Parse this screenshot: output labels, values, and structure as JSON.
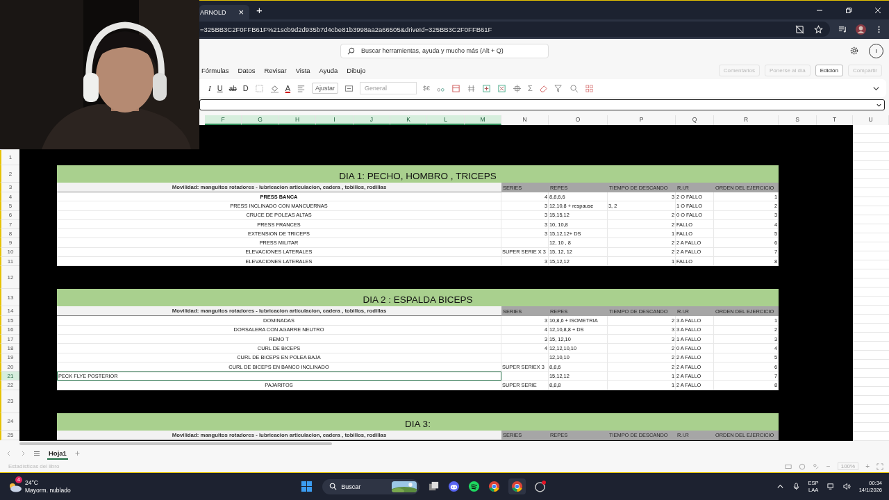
{
  "browser": {
    "tab_title": "ARNOLD",
    "tab_close": "×",
    "new_tab": "+",
    "url": "=325BB3C2F0FFB61F%21scb9d2d935b7d4cbe81b3998aa2a66505&driveId=325BB3C2F0FFB61F"
  },
  "app": {
    "search_placeholder": "Buscar herramientas, ayuda y mucho más (Alt + Q)",
    "user_initial": "I",
    "menu": [
      "Fórmulas",
      "Datos",
      "Revisar",
      "Vista",
      "Ayuda",
      "Dibujo"
    ],
    "actions": [
      {
        "label": "Comentarios",
        "disabled": true
      },
      {
        "label": "Ponerse al día",
        "disabled": true
      },
      {
        "label": "Edición",
        "disabled": false
      },
      {
        "label": "Compartir",
        "disabled": true
      }
    ],
    "toolbar": {
      "glyphs": [
        "I",
        "U",
        "ab",
        "D"
      ],
      "font_color": "A",
      "wrap": "Ajustar",
      "number_format": "General",
      "currency": "$€",
      "sum": "Σ"
    }
  },
  "columns": [
    {
      "label": "F",
      "selected": true
    },
    {
      "label": "G",
      "selected": true
    },
    {
      "label": "H",
      "selected": true
    },
    {
      "label": "I",
      "selected": true
    },
    {
      "label": "J",
      "selected": true
    },
    {
      "label": "K",
      "selected": true
    },
    {
      "label": "L",
      "selected": true
    },
    {
      "label": "M",
      "selected": true
    },
    {
      "label": "N",
      "selected": false
    },
    {
      "label": "O",
      "selected": false
    },
    {
      "label": "P",
      "selected": false
    },
    {
      "label": "Q",
      "selected": false
    },
    {
      "label": "R",
      "selected": false
    },
    {
      "label": "S",
      "selected": false
    },
    {
      "label": "T",
      "selected": false
    },
    {
      "label": "U",
      "selected": false
    }
  ],
  "sheet": {
    "rows": [
      {
        "number": "1",
        "kind": "blank",
        "selected": false
      },
      {
        "number": "2",
        "kind": "title",
        "selected": false,
        "text": "DIA 1: PECHO, HOMBRO , TRICEPS"
      },
      {
        "number": "3",
        "kind": "header",
        "selected": false,
        "mobility": "Movilidad: manguitos rotadores - lubricacion articulacion, cadera , tobillos, rodillas",
        "headers": [
          "SERIES",
          "REPES",
          "TIEMPO DE DESCANDO",
          "R.I.R",
          "ORDEN DEL EJERCICIO"
        ]
      },
      {
        "number": "4",
        "kind": "exercise",
        "selected": false,
        "bold": true,
        "cells": [
          "PRESS BANCA",
          "4",
          "8,8,6,6",
          "3",
          "2 O FALLO",
          "1"
        ]
      },
      {
        "number": "5",
        "kind": "exercise",
        "selected": false,
        "bold": false,
        "cells": [
          "PRESS INCLINADO CON MANCUERNAS",
          "3",
          "12,10,8 + respause",
          "3, 2",
          "1 O FALLO",
          "2"
        ]
      },
      {
        "number": "6",
        "kind": "exercise",
        "selected": false,
        "bold": false,
        "cells": [
          "CRUCE DE POLEAS ALTAS",
          "3",
          "15,15,12",
          "2",
          "0 O FALLO",
          "3"
        ]
      },
      {
        "number": "7",
        "kind": "exercise",
        "selected": false,
        "bold": false,
        "cells": [
          "PRESS FRANCES",
          "3",
          "10, 10,8",
          "2",
          "FALLO",
          "4"
        ]
      },
      {
        "number": "8",
        "kind": "exercise",
        "selected": false,
        "bold": false,
        "cells": [
          "EXTENSION DE TRICEPS",
          "3",
          "15,12,12+ DS",
          "1",
          "FALLO",
          "5"
        ]
      },
      {
        "number": "9",
        "kind": "exercise",
        "selected": false,
        "bold": false,
        "cells": [
          "PRESS MILITAR",
          "",
          "12, 10 , 8",
          "2",
          "2 A FALLO",
          "6"
        ]
      },
      {
        "number": "10",
        "kind": "exercise",
        "selected": false,
        "bold": false,
        "cells": [
          "ELEVACIONES LATERALES",
          "SUPER SERIE X 3",
          "15, 12, 12",
          "2",
          "2 A FALLO",
          "7"
        ]
      },
      {
        "number": "11",
        "kind": "exercise",
        "selected": false,
        "bold": false,
        "cells": [
          "ELEVACIONES LATERALES",
          "3",
          "15,12,12",
          "1",
          "FALLO",
          "8"
        ]
      },
      {
        "number": "12",
        "kind": "blank",
        "selected": false
      },
      {
        "number": "13",
        "kind": "title",
        "selected": false,
        "text": "DIA 2 : ESPALDA BICEPS"
      },
      {
        "number": "14",
        "kind": "header",
        "selected": false,
        "mobility": "Movilidad: manguitos rotadores - lubricacion articulacion, cadera , tobillos, rodillas",
        "headers": [
          "SERIES",
          "REPES",
          "TIEMPO DE DESCANDO",
          "R.I.R",
          "ORDEN DEL EJERCICIO"
        ]
      },
      {
        "number": "15",
        "kind": "exercise",
        "selected": false,
        "bold": false,
        "cells": [
          "DOMINADAS",
          "3",
          "10,8,6 + ISOMETRIA",
          "2",
          "3 A FALLO",
          "1"
        ]
      },
      {
        "number": "16",
        "kind": "exercise",
        "selected": false,
        "bold": false,
        "cells": [
          "DORSALERA CON AGARRE NEUTRO",
          "4",
          "12,10,8,8 + DS",
          "3",
          "3 A FALLO",
          "2"
        ]
      },
      {
        "number": "17",
        "kind": "exercise",
        "selected": false,
        "bold": false,
        "cells": [
          "REMO T",
          "3",
          "15, 12,10",
          "3",
          "1 A FALLO",
          "3"
        ]
      },
      {
        "number": "18",
        "kind": "exercise",
        "selected": false,
        "bold": false,
        "cells": [
          "CURL DE BICEPS",
          "4",
          "12,12,10,10",
          "2",
          "0 A FALLO",
          "4"
        ]
      },
      {
        "number": "19",
        "kind": "exercise",
        "selected": false,
        "bold": false,
        "cells": [
          "CURL DE BICEPS EN POLEA BAJA",
          "",
          "12,10,10",
          "2",
          "2 A FALLO",
          "5"
        ]
      },
      {
        "number": "20",
        "kind": "exercise",
        "selected": false,
        "bold": false,
        "cells": [
          "CURL DE BICEPS EN BANCO INCLINADO",
          "SUPER SERIEX 3",
          "8,8,6",
          "2",
          "2 A FALLO",
          "6"
        ]
      },
      {
        "number": "21",
        "kind": "exercise",
        "selected": true,
        "bold": false,
        "cells": [
          "PECK FLYE POSTERIOR",
          "",
          "15,12,12",
          "1",
          "2 A FALLO",
          "7"
        ]
      },
      {
        "number": "22",
        "kind": "exercise",
        "selected": false,
        "bold": false,
        "cells": [
          "PAJARITOS",
          "SUPER SERIE",
          "8,8,8",
          "1",
          "2 A FALLO",
          "8"
        ]
      },
      {
        "number": "23",
        "kind": "blank",
        "selected": false
      },
      {
        "number": "24",
        "kind": "title",
        "selected": false,
        "text": "DIA 3:"
      },
      {
        "number": "25",
        "kind": "header",
        "selected": false,
        "mobility": "Movilidad: manguitos rotadores - lubricacion articulacion, cadera , tobillos, rodillas",
        "headers": [
          "SERIES",
          "REPES",
          "TIEMPO DE DESCANDO",
          "R.I.R",
          "ORDEN DEL EJERCICIO"
        ]
      }
    ]
  },
  "sheet_tabs": [
    {
      "label": "Hoja1",
      "selected": true
    }
  ],
  "add_sheet": "+",
  "status": {
    "left": "Estadísticas del libro",
    "zoom": "100%",
    "zoom_out": "−",
    "zoom_in": "+"
  },
  "taskbar": {
    "weather_badge": "4",
    "temperature": "24°C",
    "weather": "Mayorm. nublado",
    "search": "Buscar",
    "language": "ESP",
    "layout": "LAA",
    "time": "00:34",
    "date": "14/1/2026"
  }
}
